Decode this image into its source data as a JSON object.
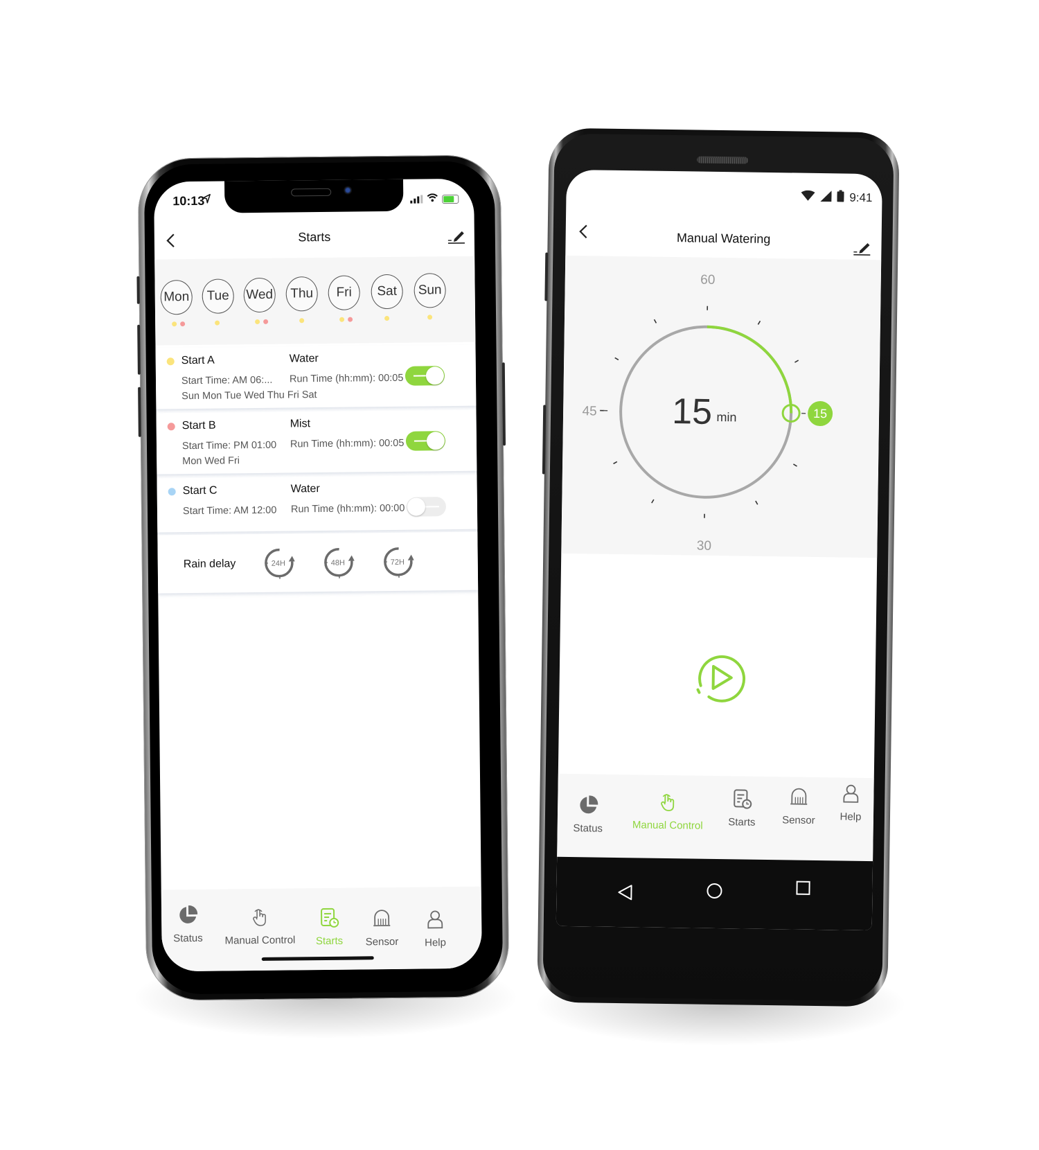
{
  "colors": {
    "accent": "#8fd63e",
    "start_a": "#fbe47c",
    "start_b": "#f59a9a",
    "start_c": "#a8d4f5",
    "inactive_icon": "#6b6b6b"
  },
  "iphone": {
    "status_bar": {
      "time": "10:13",
      "location_icon": "location-arrow-icon",
      "signal_icon": "cellular-signal-icon",
      "wifi_icon": "wifi-icon",
      "battery_icon": "battery-charging-icon"
    },
    "nav": {
      "title": "Starts",
      "back_icon": "chevron-left-icon",
      "edit_icon": "edit-pencil-icon"
    },
    "days": [
      {
        "label": "Mon",
        "starts": [
          "A",
          "B"
        ]
      },
      {
        "label": "Tue",
        "starts": [
          "A"
        ]
      },
      {
        "label": "Wed",
        "starts": [
          "A",
          "B"
        ]
      },
      {
        "label": "Thu",
        "starts": [
          "A"
        ]
      },
      {
        "label": "Fri",
        "starts": [
          "A",
          "B"
        ]
      },
      {
        "label": "Sat",
        "starts": [
          "A"
        ]
      },
      {
        "label": "Sun",
        "starts": [
          "A"
        ]
      }
    ],
    "starts": [
      {
        "name": "Start A",
        "type": "Water",
        "start_time": "Start Time: AM 06:...",
        "run_time": "Run Time (hh:mm): 00:05",
        "days": "Sun Mon Tue Wed Thu Fri Sat",
        "enabled": true,
        "color": "#fbe47c"
      },
      {
        "name": "Start B",
        "type": "Mist",
        "start_time": "Start Time: PM 01:00",
        "run_time": "Run Time (hh:mm): 00:05",
        "days": "Mon Wed Fri",
        "enabled": true,
        "color": "#f59a9a"
      },
      {
        "name": "Start C",
        "type": "Water",
        "start_time": "Start Time: AM 12:00",
        "run_time": "Run Time (hh:mm): 00:00",
        "days": "",
        "enabled": false,
        "color": "#a8d4f5"
      }
    ],
    "rain_delay": {
      "label": "Rain delay",
      "options": [
        "24H",
        "48H",
        "72H"
      ]
    },
    "tabs": [
      {
        "label": "Status",
        "icon": "pie-chart-icon",
        "active": false
      },
      {
        "label": "Manual Control",
        "icon": "hand-pointer-icon",
        "active": false
      },
      {
        "label": "Starts",
        "icon": "schedule-doc-clock-icon",
        "active": true
      },
      {
        "label": "Sensor",
        "icon": "sensor-dome-icon",
        "active": false
      },
      {
        "label": "Help",
        "icon": "user-icon",
        "active": false
      }
    ]
  },
  "android": {
    "status_bar": {
      "time": "9:41",
      "wifi_icon": "wifi-icon",
      "signal_icon": "cellular-signal-icon",
      "battery_icon": "battery-icon"
    },
    "nav": {
      "title": "Manual Watering",
      "back_icon": "chevron-left-icon",
      "edit_icon": "edit-pencil-icon"
    },
    "timer": {
      "value": "15",
      "unit": "min",
      "max_minutes": 60,
      "selected_minutes": 15,
      "dial_labels": {
        "top": "60",
        "right": "15",
        "bottom": "30",
        "left": "45"
      },
      "handle_label": "15"
    },
    "play_button": {
      "icon": "play-circle-icon"
    },
    "tabs": [
      {
        "label": "Status",
        "icon": "pie-chart-icon",
        "active": false
      },
      {
        "label": "Manual Control",
        "icon": "hand-pointer-icon",
        "active": true
      },
      {
        "label": "Starts",
        "icon": "schedule-doc-clock-icon",
        "active": false
      },
      {
        "label": "Sensor",
        "icon": "sensor-dome-icon",
        "active": false
      },
      {
        "label": "Help",
        "icon": "user-icon",
        "active": false
      }
    ],
    "system_nav": [
      {
        "icon": "back-triangle-icon"
      },
      {
        "icon": "home-circle-icon"
      },
      {
        "icon": "recents-square-icon"
      }
    ]
  }
}
